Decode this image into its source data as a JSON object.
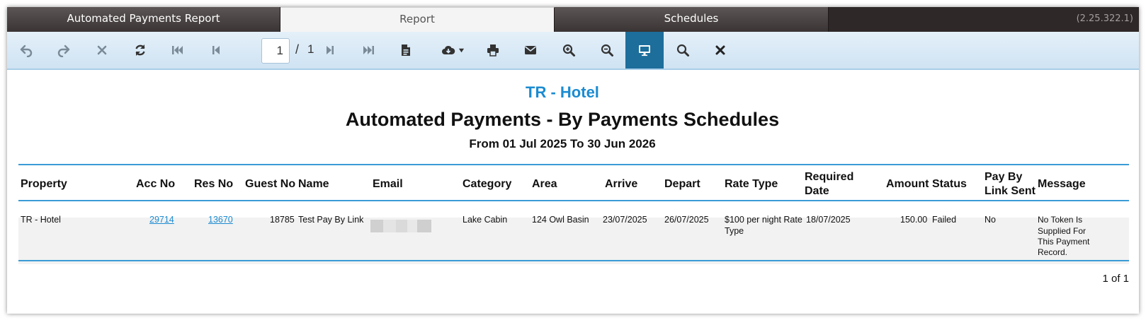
{
  "tabs": [
    {
      "label": "Automated Payments Report",
      "active": false
    },
    {
      "label": "Report",
      "active": true
    },
    {
      "label": "Schedules",
      "active": false
    }
  ],
  "version": "(2.25.322.1)",
  "toolbar": {
    "buttons": [
      {
        "name": "undo-button",
        "icon": "undo-icon"
      },
      {
        "name": "redo-button",
        "icon": "redo-icon"
      },
      {
        "name": "cancel-button",
        "icon": "close-icon"
      },
      {
        "name": "refresh-button",
        "icon": "refresh-icon"
      },
      {
        "name": "first-page-button",
        "icon": "first-page-icon"
      },
      {
        "name": "previous-page-button",
        "icon": "previous-page-icon"
      },
      {
        "name": "next-page-button",
        "icon": "next-page-icon"
      },
      {
        "name": "last-page-button",
        "icon": "last-page-icon"
      },
      {
        "name": "document-button",
        "icon": "document-icon"
      },
      {
        "name": "export-button",
        "icon": "cloud-download-icon"
      },
      {
        "name": "print-button",
        "icon": "print-icon"
      },
      {
        "name": "email-button",
        "icon": "envelope-icon"
      },
      {
        "name": "zoom-in-button",
        "icon": "zoom-in-icon"
      },
      {
        "name": "zoom-out-button",
        "icon": "zoom-out-icon"
      },
      {
        "name": "view-mode-button",
        "icon": "monitor-icon"
      },
      {
        "name": "search-button",
        "icon": "search-icon"
      },
      {
        "name": "close-report-button",
        "icon": "close-icon"
      }
    ],
    "page_current": "1",
    "page_separator": "/",
    "page_total": "1"
  },
  "colors": {
    "accent": "#1b8bd1",
    "toolbar_active": "#1d6e9b",
    "rule": "#3a9bd6"
  },
  "report": {
    "property_name": "TR - Hotel",
    "title": "Automated Payments - By Payments Schedules",
    "date_range": "From 01 Jul 2025 To 30 Jun 2026",
    "columns": {
      "property": "Property",
      "acc_no": "Acc No",
      "res_no": "Res No",
      "guest_no": "Guest No",
      "name": "Name",
      "email": "Email",
      "category": "Category",
      "area": "Area",
      "arrive": "Arrive",
      "depart": "Depart",
      "rate_type": "Rate Type",
      "required_date_1": "Required",
      "required_date_2": "Date",
      "amount": "Amount",
      "status": "Status",
      "pay_by_link_1": "Pay By",
      "pay_by_link_2": "Link Sent",
      "message": "Message"
    },
    "rows": [
      {
        "property": "TR - Hotel",
        "acc_no": "29714",
        "res_no": "13670",
        "guest_no": "18785",
        "name": "Test Pay By Link",
        "category": "Lake Cabin",
        "area": "124 Owl Basin",
        "arrive": "23/07/2025",
        "depart": "26/07/2025",
        "rate_type_1": "$100 per night Rate",
        "rate_type_2": "Type",
        "required_date": "18/07/2025",
        "amount": "150.00",
        "status": "Failed",
        "pay_by_link": "No",
        "message_1": "No Token Is",
        "message_2": "Supplied For",
        "message_3": "This Payment",
        "message_4": "Record."
      }
    ],
    "pager": "1 of 1"
  }
}
